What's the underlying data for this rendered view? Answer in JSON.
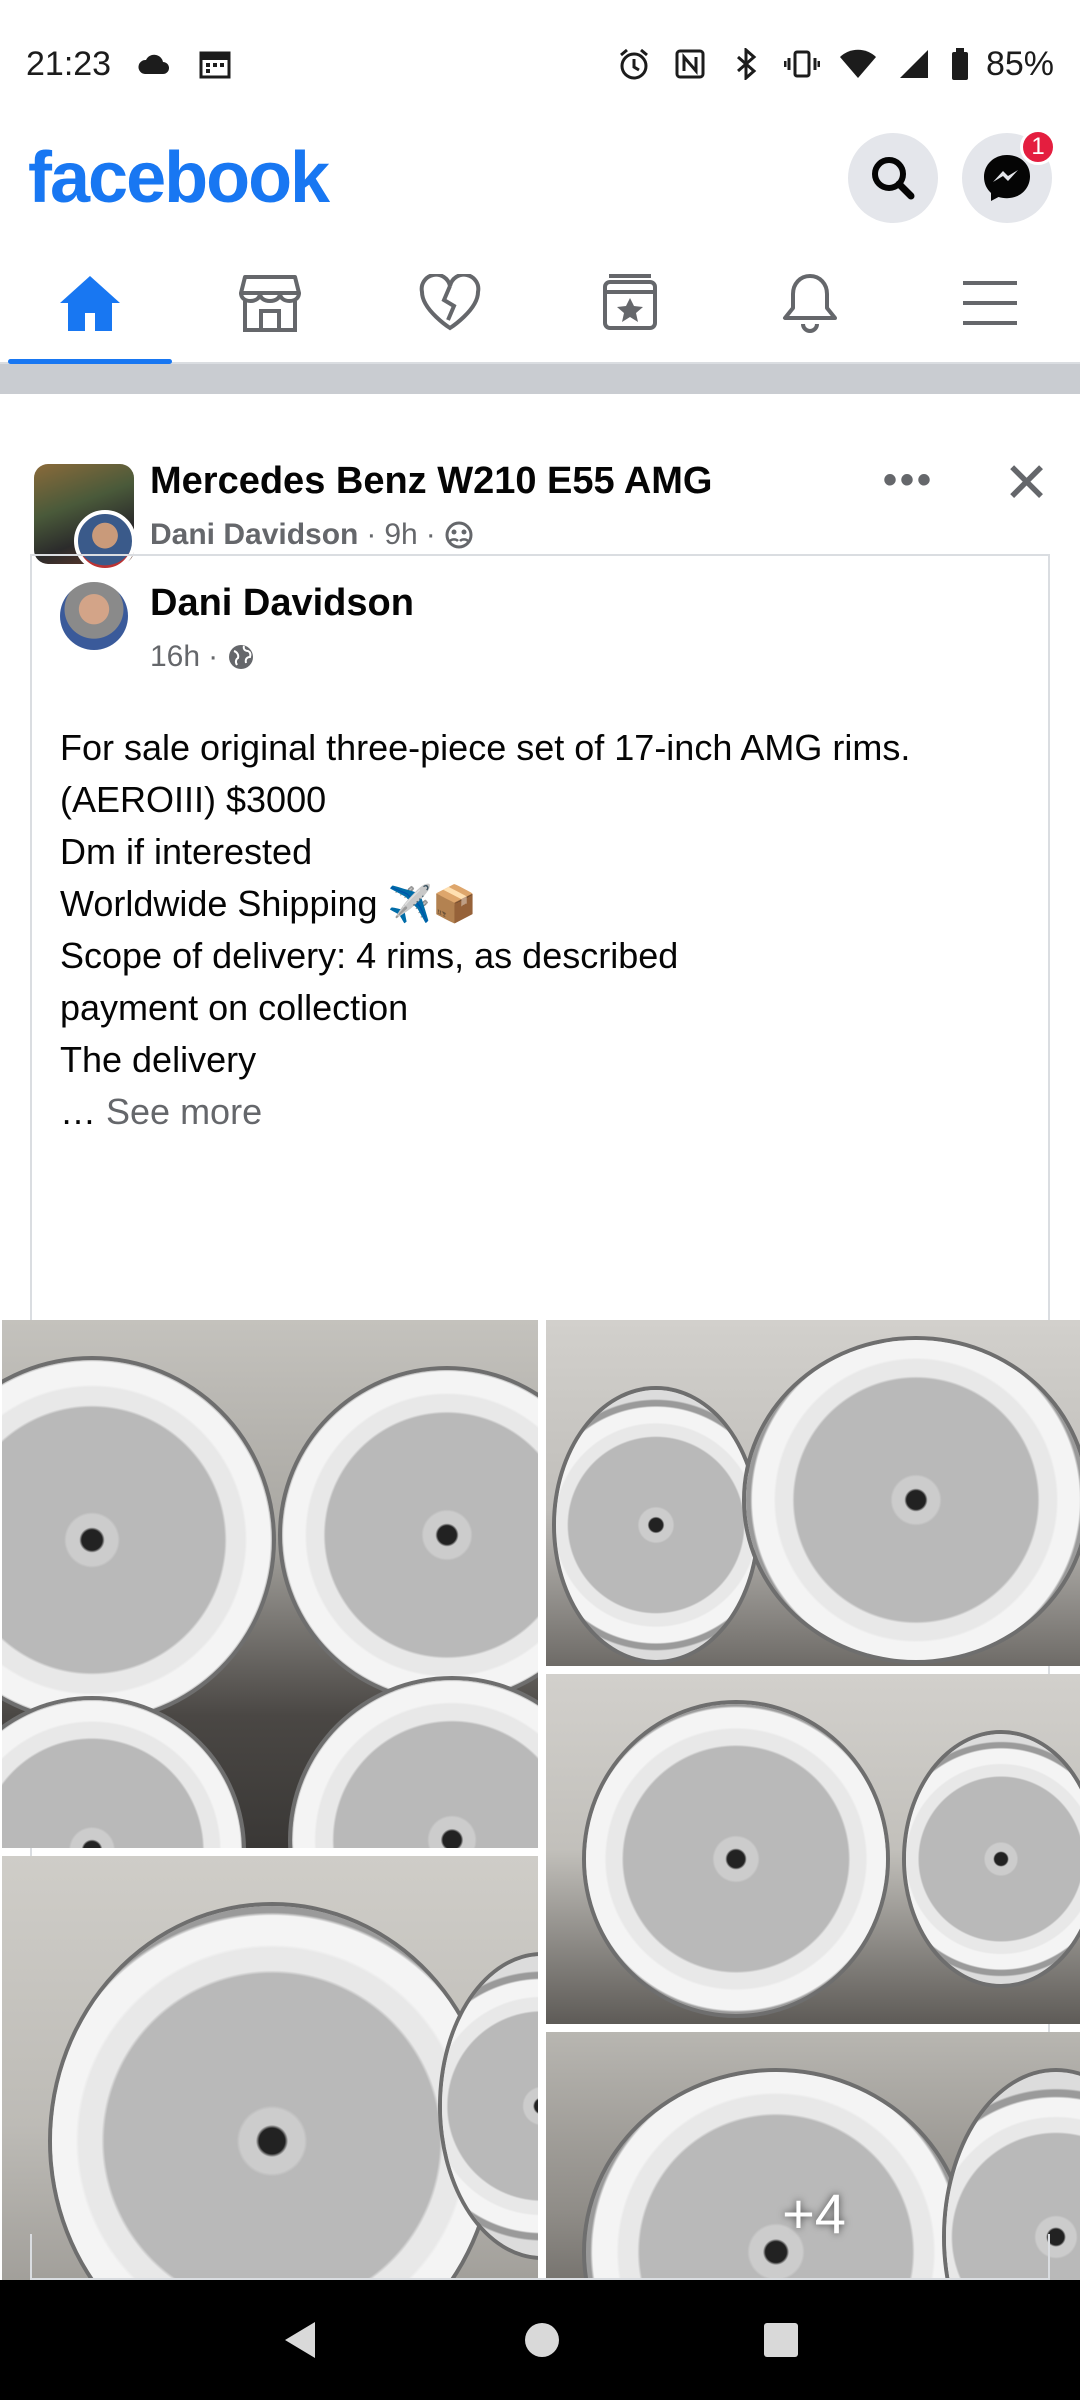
{
  "status_bar": {
    "time": "21:23",
    "battery": "85%",
    "icons_left": [
      "cloud-icon",
      "calendar-icon"
    ],
    "icons_right": [
      "alarm-icon",
      "nfc-icon",
      "bluetooth-icon",
      "vibrate-icon",
      "wifi-icon",
      "signal-icon",
      "battery-icon"
    ]
  },
  "header": {
    "logo": "facebook",
    "messenger_badge": "1"
  },
  "tabs": [
    {
      "name": "home",
      "icon": "home-icon",
      "active": true
    },
    {
      "name": "marketplace",
      "icon": "marketplace-icon",
      "active": false
    },
    {
      "name": "dating",
      "icon": "heart-icon",
      "active": false
    },
    {
      "name": "saved",
      "icon": "saved-icon",
      "active": false
    },
    {
      "name": "notifications",
      "icon": "bell-icon",
      "active": false
    },
    {
      "name": "menu",
      "icon": "menu-icon",
      "active": false
    }
  ],
  "post": {
    "group_name": "Mercedes Benz W210 E55 AMG",
    "poster": "Dani Davidson",
    "time": "9h",
    "more_label": "•••",
    "close_label": "✕",
    "shared": {
      "author": "Dani Davidson",
      "time": "16h",
      "text_lines": [
        "For sale  original three-piece set of 17-inch AMG rims.",
        "(AEROIII) $3000",
        "Dm if interested",
        "Worldwide Shipping ✈️📦",
        "Scope of delivery: 4 rims, as described",
        "payment on collection",
        "The delivery"
      ],
      "see_more": "See more",
      "ellipsis": "… "
    },
    "photos": {
      "extra_count": "+4"
    }
  },
  "colors": {
    "brand": "#1877f2",
    "badge": "#e41e3f",
    "secondary_text": "#65676b"
  }
}
